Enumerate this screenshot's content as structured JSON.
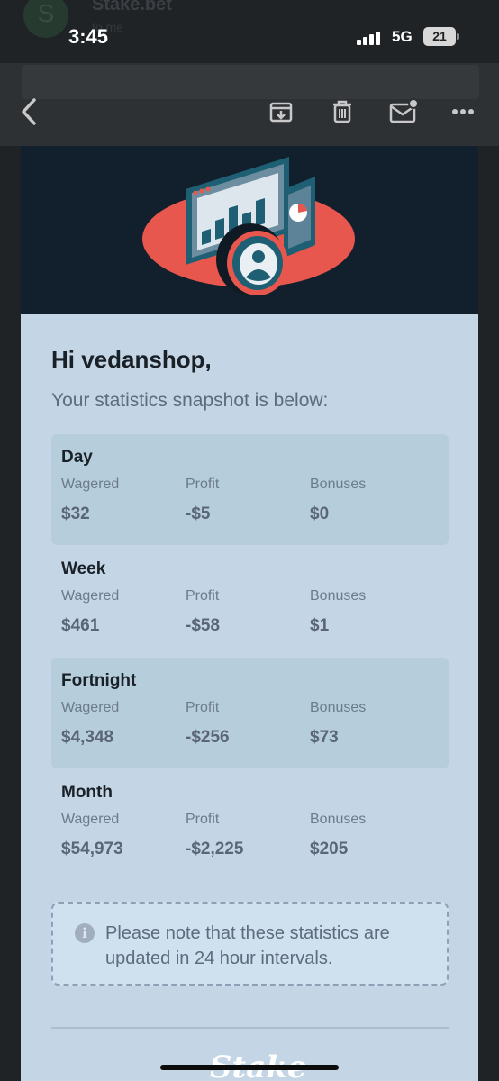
{
  "background_header": {
    "avatar_letter": "S",
    "sender": "Stake.bet",
    "sub": "to me"
  },
  "status_bar": {
    "time": "3:45",
    "network": "5G",
    "battery": "21"
  },
  "toolbar": {
    "icons": [
      "back-icon",
      "archive-icon",
      "trash-icon",
      "mark-unread-icon",
      "more-icon"
    ]
  },
  "email": {
    "greeting": "Hi vedanshop,",
    "intro": "Your statistics snapshot is below:",
    "periods": [
      {
        "title": "Day",
        "wagered_label": "Wagered",
        "wagered": "$32",
        "profit_label": "Profit",
        "profit": "-$5",
        "bonuses_label": "Bonuses",
        "bonuses": "$0"
      },
      {
        "title": "Week",
        "wagered_label": "Wagered",
        "wagered": "$461",
        "profit_label": "Profit",
        "profit": "-$58",
        "bonuses_label": "Bonuses",
        "bonuses": "$1"
      },
      {
        "title": "Fortnight",
        "wagered_label": "Wagered",
        "wagered": "$4,348",
        "profit_label": "Profit",
        "profit": "-$256",
        "bonuses_label": "Bonuses",
        "bonuses": "$73"
      },
      {
        "title": "Month",
        "wagered_label": "Wagered",
        "wagered": "$54,973",
        "profit_label": "Profit",
        "profit": "-$2,225",
        "bonuses_label": "Bonuses",
        "bonuses": "$205"
      }
    ],
    "notice_icon": "i",
    "notice": "Please note that these statistics are updated in 24 hour intervals.",
    "footer_logo": "Stake"
  },
  "colors": {
    "hero_bg": "#121f2d",
    "card_bg": "#c4d6e5",
    "accent_red": "#e8574e",
    "teal": "#1e5f73"
  }
}
